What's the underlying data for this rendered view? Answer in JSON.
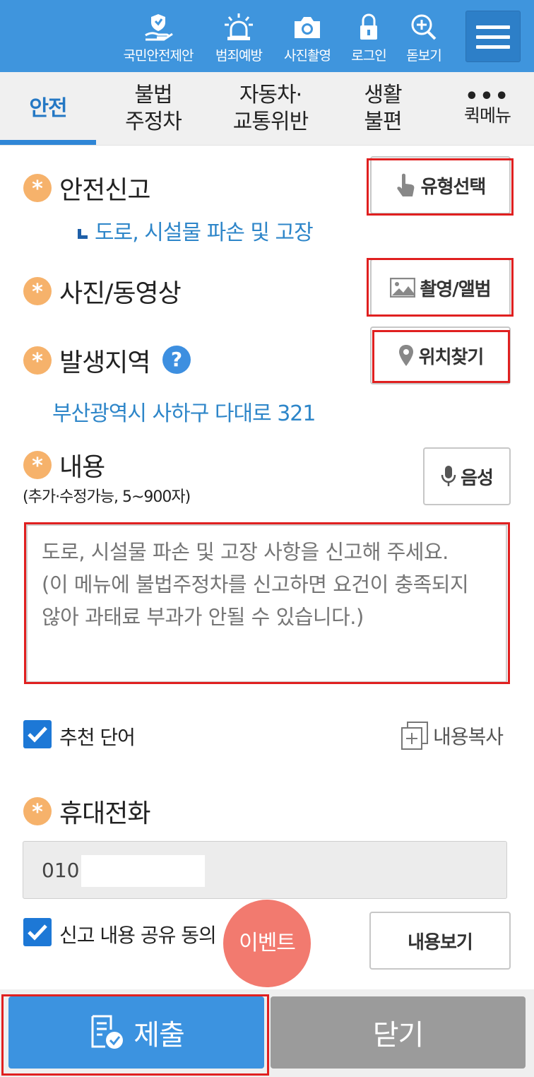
{
  "top_nav": {
    "items": [
      {
        "label": "국민안전제안",
        "icon": "hand-shield-icon"
      },
      {
        "label": "범죄예방",
        "icon": "siren-icon"
      },
      {
        "label": "사진촬영",
        "icon": "camera-icon"
      },
      {
        "label": "로그인",
        "icon": "lock-icon"
      },
      {
        "label": "돋보기",
        "icon": "magnifier-plus-icon"
      }
    ],
    "menu_icon": "hamburger-menu-icon"
  },
  "tabs": [
    {
      "line1": "안전",
      "line2": "",
      "active": true
    },
    {
      "line1": "불법",
      "line2": "주정차",
      "active": false
    },
    {
      "line1": "자동차·",
      "line2": "교통위반",
      "active": false
    },
    {
      "line1": "생활",
      "line2": "불편",
      "active": false
    }
  ],
  "quick_menu": {
    "dots": "•••",
    "label": "퀵메뉴"
  },
  "form": {
    "required_mark": "*",
    "safety_report": {
      "label": "안전신고",
      "category": "도로, 시설물 파손 및 고장",
      "button": "유형선택",
      "button_icon": "finger-tap-icon"
    },
    "media": {
      "label": "사진/동영상",
      "button": "촬영/앨범",
      "button_icon": "image-icon"
    },
    "location": {
      "label": "발생지역",
      "help": "?",
      "button": "위치찾기",
      "button_icon": "map-pin-icon",
      "address": "부산광역시 사하구 다대로 321"
    },
    "content": {
      "label": "내용",
      "note": "(추가·수정가능, 5~900자)",
      "voice_button": "음성",
      "voice_icon": "microphone-icon",
      "placeholder": "도로, 시설물 파손 및 고장 사항을 신고해 주세요.\n(이 메뉴에 불법주정차를 신고하면 요건이 충족되지 않아 과태료 부과가 안될 수 있습니다.)"
    },
    "recommend": {
      "label": "추천 단어",
      "checked": true
    },
    "copy": {
      "label": "내용복사",
      "icon": "copy-plus-icon"
    },
    "phone": {
      "label": "휴대전화",
      "value": "010"
    },
    "share_consent": {
      "label": "신고 내용 공유 동의",
      "checked": true
    },
    "view_button": "내용보기",
    "event_badge": "이벤트"
  },
  "bottom": {
    "submit": "제출",
    "submit_icon": "document-check-icon",
    "close": "닫기"
  },
  "colors": {
    "primary": "#3f95dd",
    "accent_orange": "#f6b26b",
    "highlight_red": "#e02020",
    "link_blue": "#2e86c9"
  }
}
